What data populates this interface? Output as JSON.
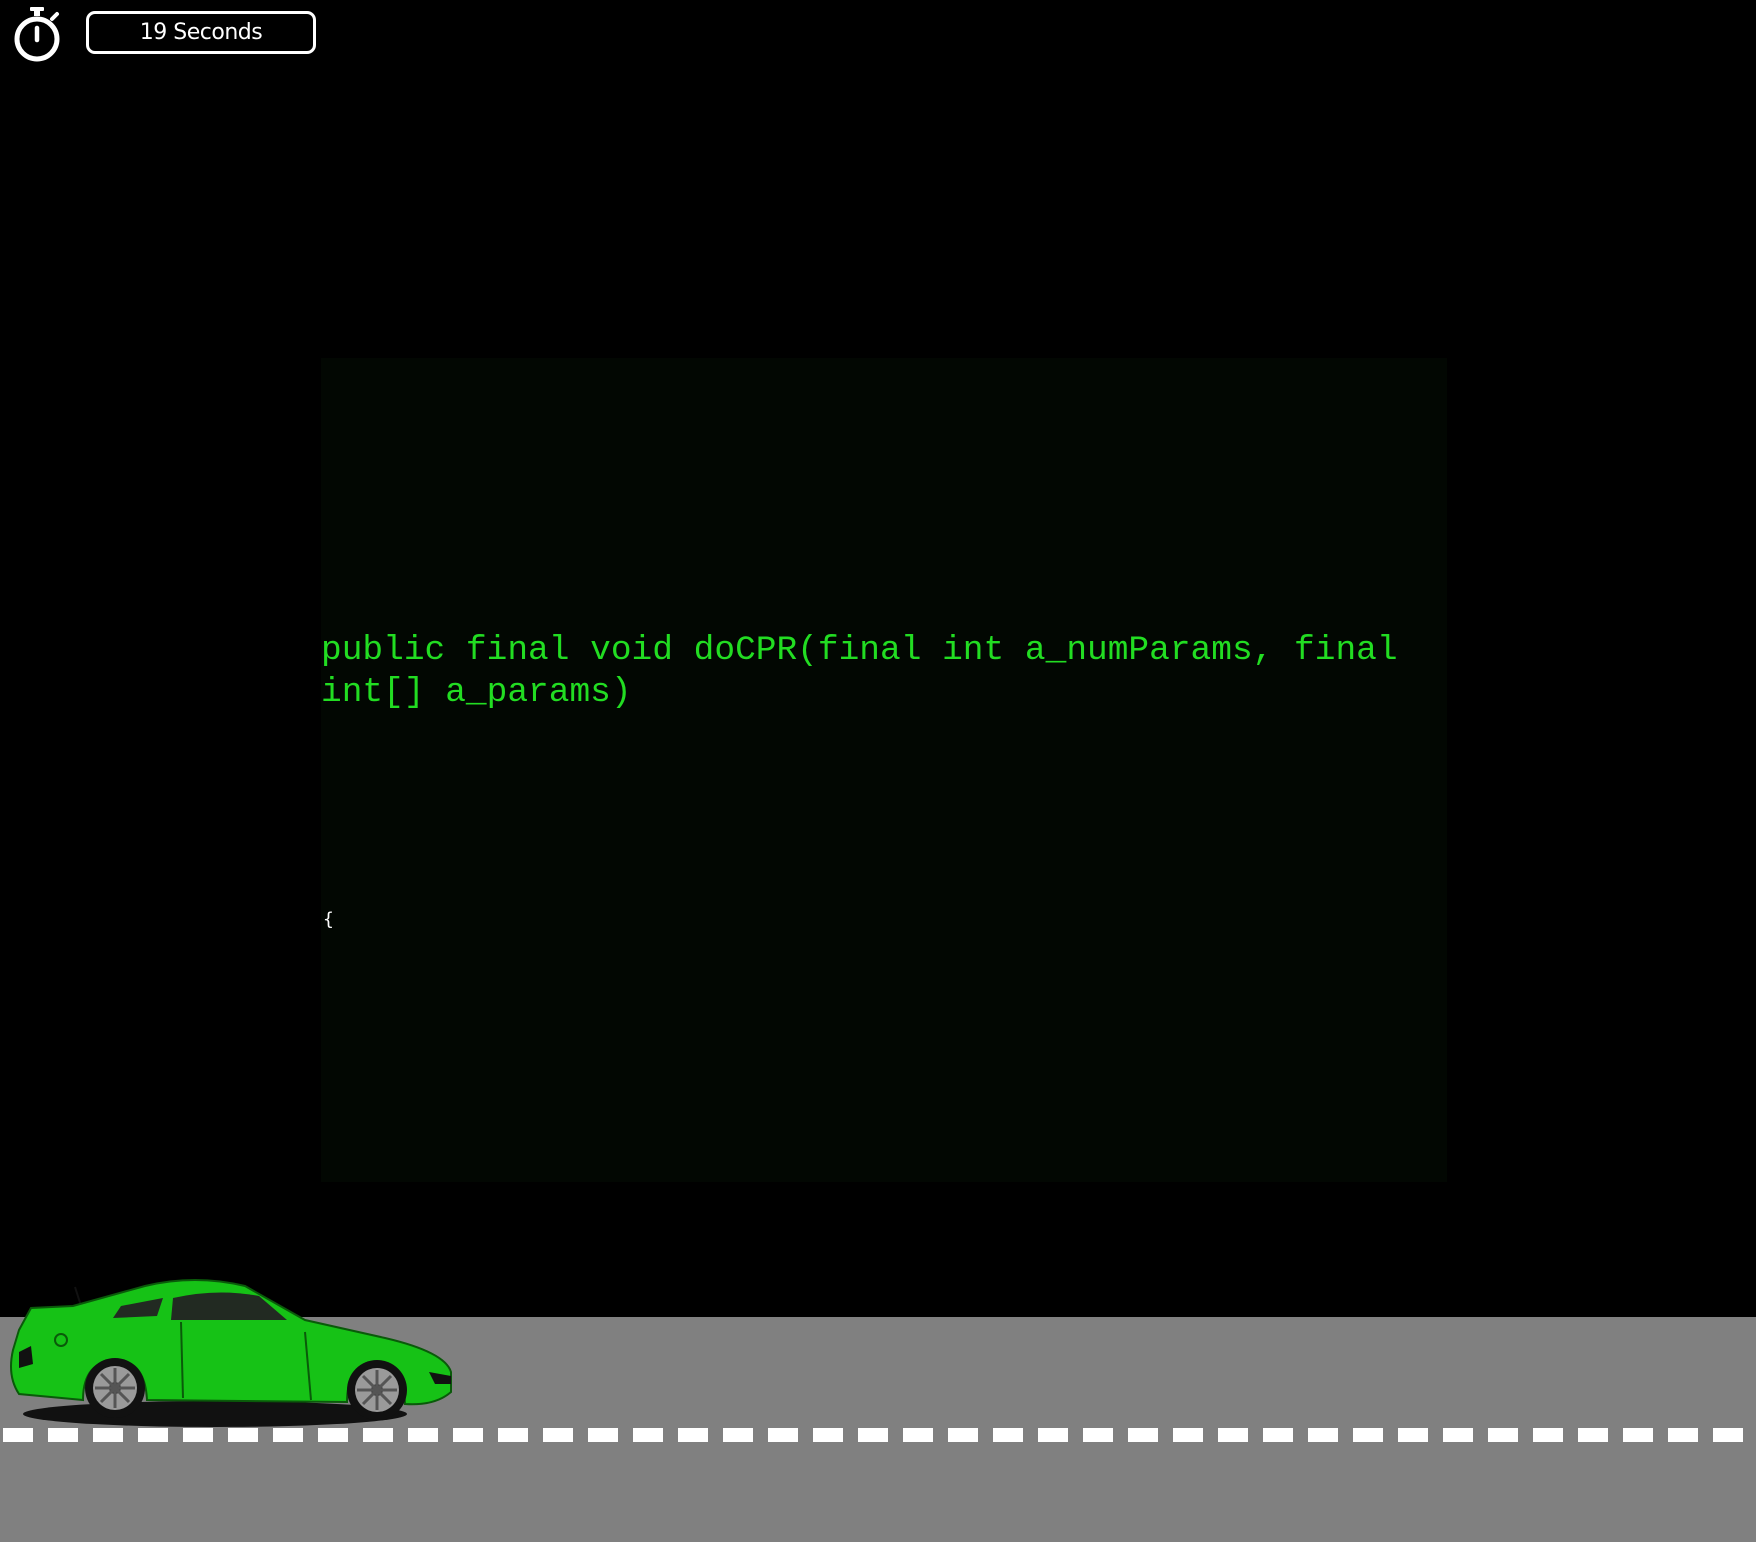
{
  "timer": {
    "icon": "stopwatch-icon",
    "label": "19 Seconds"
  },
  "code": {
    "current_line": "public final void doCPR(final int a_numParams, final int[] a_params)",
    "next_line": "{"
  },
  "colors": {
    "background": "#000000",
    "code_text": "#22dd22",
    "next_text": "#ffffff",
    "road": "#808080",
    "lane_marking": "#ffffff",
    "car_body": "#16c216"
  },
  "car": {
    "icon": "green-sports-car-icon"
  }
}
